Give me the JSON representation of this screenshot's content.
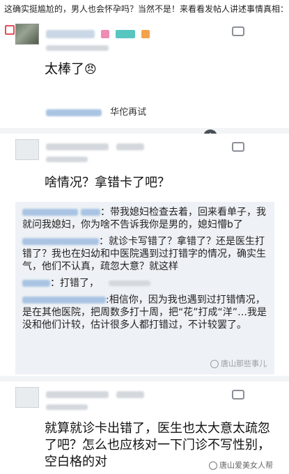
{
  "headline": "这确实挺尴尬的，男人也会怀孕吗？当然不是！来看看发帖人讲述事情真相：",
  "post1": {
    "body": "太棒了",
    "emoji": "😠",
    "reply_author_suffix": "华佗再试",
    "colors": {
      "badge_pink": "#f08bb3",
      "badge_teal": "#58c6c0",
      "badge_orange": "#f3a24a"
    }
  },
  "post2": {
    "body": "啥情况？拿错卡了吧？",
    "replies": [
      {
        "text": "：带我媳妇检查去着，回来看单子，我就问我媳妇，你为啥不告诉我你是男的，媳妇懵b了"
      },
      {
        "text": "：就诊卡写错了？拿错了？还是医生打错了？我也在妇幼和中医院遇到过打错字的情况，确实生气，他们不认真，疏忽大意？就这样"
      },
      {
        "text": "：打错了，"
      },
      {
        "text": ":相信你，因为我也遇到过打错情况，是在其他医院，把周数多打十周，把“花”打成“洋”…我是没和他们计较，估计很多人都打错过，不计较罢了。"
      }
    ],
    "watermark": "唐山那些事儿"
  },
  "post3": {
    "body": "就算就诊卡出错了，医生也太大意太疏忽了吧？怎么也应核对一下门诊不写性别，空白格的对",
    "watermark": "唐山爱美女人帮"
  },
  "icons": {
    "comment": "comment-icon",
    "plus": "plus-circle-icon",
    "side": "share-square-icon"
  }
}
